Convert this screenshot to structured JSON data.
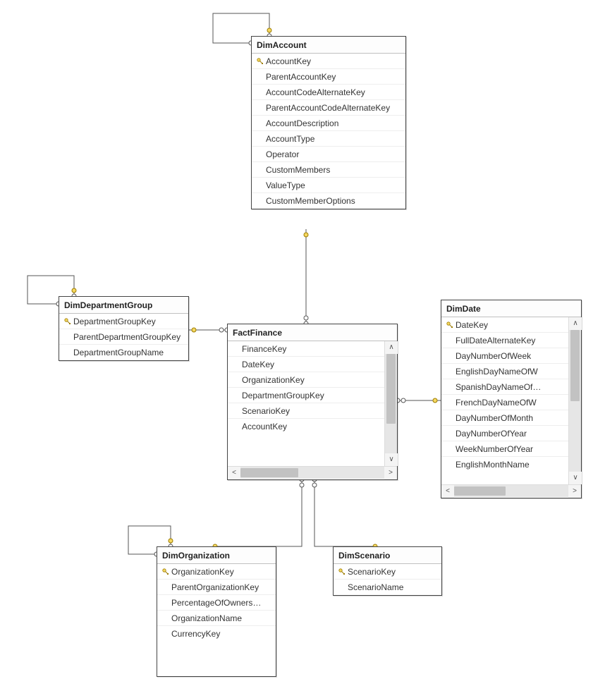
{
  "entities": {
    "dimAccount": {
      "title": "DimAccount",
      "columns": [
        {
          "name": "AccountKey",
          "pk": true
        },
        {
          "name": "ParentAccountKey",
          "pk": false
        },
        {
          "name": "AccountCodeAlternateKey",
          "pk": false
        },
        {
          "name": "ParentAccountCodeAlternateKey",
          "pk": false
        },
        {
          "name": "AccountDescription",
          "pk": false
        },
        {
          "name": "AccountType",
          "pk": false
        },
        {
          "name": "Operator",
          "pk": false
        },
        {
          "name": "CustomMembers",
          "pk": false
        },
        {
          "name": "ValueType",
          "pk": false
        },
        {
          "name": "CustomMemberOptions",
          "pk": false
        }
      ]
    },
    "dimDepartmentGroup": {
      "title": "DimDepartmentGroup",
      "columns": [
        {
          "name": "DepartmentGroupKey",
          "pk": true
        },
        {
          "name": "ParentDepartmentGroupKey",
          "pk": false
        },
        {
          "name": "DepartmentGroupName",
          "pk": false
        }
      ]
    },
    "factFinance": {
      "title": "FactFinance",
      "columns": [
        {
          "name": "FinanceKey",
          "pk": false
        },
        {
          "name": "DateKey",
          "pk": false
        },
        {
          "name": "OrganizationKey",
          "pk": false
        },
        {
          "name": "DepartmentGroupKey",
          "pk": false
        },
        {
          "name": "ScenarioKey",
          "pk": false
        },
        {
          "name": "AccountKey",
          "pk": false
        }
      ]
    },
    "dimDate": {
      "title": "DimDate",
      "columns": [
        {
          "name": "DateKey",
          "pk": true
        },
        {
          "name": "FullDateAlternateKey",
          "pk": false
        },
        {
          "name": "DayNumberOfWeek",
          "pk": false
        },
        {
          "name": "EnglishDayNameOfW",
          "pk": false
        },
        {
          "name": "SpanishDayNameOf…",
          "pk": false
        },
        {
          "name": "FrenchDayNameOfW",
          "pk": false
        },
        {
          "name": "DayNumberOfMonth",
          "pk": false
        },
        {
          "name": "DayNumberOfYear",
          "pk": false
        },
        {
          "name": "WeekNumberOfYear",
          "pk": false
        },
        {
          "name": "EnglishMonthName",
          "pk": false
        }
      ]
    },
    "dimOrganization": {
      "title": "DimOrganization",
      "columns": [
        {
          "name": "OrganizationKey",
          "pk": true
        },
        {
          "name": "ParentOrganizationKey",
          "pk": false
        },
        {
          "name": "PercentageOfOwners…",
          "pk": false
        },
        {
          "name": "OrganizationName",
          "pk": false
        },
        {
          "name": "CurrencyKey",
          "pk": false
        }
      ]
    },
    "dimScenario": {
      "title": "DimScenario",
      "columns": [
        {
          "name": "ScenarioKey",
          "pk": true
        },
        {
          "name": "ScenarioName",
          "pk": false
        }
      ]
    }
  }
}
